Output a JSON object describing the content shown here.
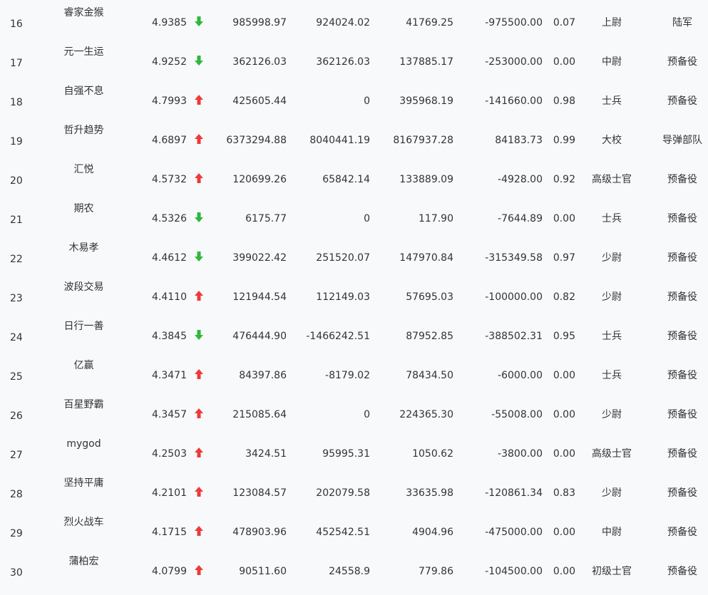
{
  "colors": {
    "up": "#ec3b3b",
    "down": "#2db83d",
    "text": "#333333",
    "background": "#f8f9fb"
  },
  "rows": [
    {
      "rank": "16",
      "name": "睿家金猴",
      "score": "4.9385",
      "trend": "down",
      "v1": "985998.97",
      "v2": "924024.02",
      "v3": "41769.25",
      "v4": "-975500.00",
      "ratio": "0.07",
      "title": "上尉",
      "unit": "陆军"
    },
    {
      "rank": "17",
      "name": "元一生运",
      "score": "4.9252",
      "trend": "down",
      "v1": "362126.03",
      "v2": "362126.03",
      "v3": "137885.17",
      "v4": "-253000.00",
      "ratio": "0.00",
      "title": "中尉",
      "unit": "预备役"
    },
    {
      "rank": "18",
      "name": "自强不息",
      "score": "4.7993",
      "trend": "up",
      "v1": "425605.44",
      "v2": "0",
      "v3": "395968.19",
      "v4": "-141660.00",
      "ratio": "0.98",
      "title": "士兵",
      "unit": "预备役"
    },
    {
      "rank": "19",
      "name": "哲升趋势",
      "score": "4.6897",
      "trend": "up",
      "v1": "6373294.88",
      "v2": "8040441.19",
      "v3": "8167937.28",
      "v4": "84183.73",
      "ratio": "0.99",
      "title": "大校",
      "unit": "导弹部队"
    },
    {
      "rank": "20",
      "name": "汇悦",
      "score": "4.5732",
      "trend": "up",
      "v1": "120699.26",
      "v2": "65842.14",
      "v3": "133889.09",
      "v4": "-4928.00",
      "ratio": "0.92",
      "title": "高级士官",
      "unit": "预备役"
    },
    {
      "rank": "21",
      "name": "期农",
      "score": "4.5326",
      "trend": "down",
      "v1": "6175.77",
      "v2": "0",
      "v3": "117.90",
      "v4": "-7644.89",
      "ratio": "0.00",
      "title": "士兵",
      "unit": "预备役"
    },
    {
      "rank": "22",
      "name": "木易孝",
      "score": "4.4612",
      "trend": "down",
      "v1": "399022.42",
      "v2": "251520.07",
      "v3": "147970.84",
      "v4": "-315349.58",
      "ratio": "0.97",
      "title": "少尉",
      "unit": "预备役"
    },
    {
      "rank": "23",
      "name": "波段交易",
      "score": "4.4110",
      "trend": "up",
      "v1": "121944.54",
      "v2": "112149.03",
      "v3": "57695.03",
      "v4": "-100000.00",
      "ratio": "0.82",
      "title": "少尉",
      "unit": "预备役"
    },
    {
      "rank": "24",
      "name": "日行一善",
      "score": "4.3845",
      "trend": "down",
      "v1": "476444.90",
      "v2": "-1466242.51",
      "v3": "87952.85",
      "v4": "-388502.31",
      "ratio": "0.95",
      "title": "士兵",
      "unit": "预备役"
    },
    {
      "rank": "25",
      "name": "亿赢",
      "score": "4.3471",
      "trend": "up",
      "v1": "84397.86",
      "v2": "-8179.02",
      "v3": "78434.50",
      "v4": "-6000.00",
      "ratio": "0.00",
      "title": "士兵",
      "unit": "预备役"
    },
    {
      "rank": "26",
      "name": "百星野霸",
      "score": "4.3457",
      "trend": "up",
      "v1": "215085.64",
      "v2": "0",
      "v3": "224365.30",
      "v4": "-55008.00",
      "ratio": "0.00",
      "title": "少尉",
      "unit": "预备役"
    },
    {
      "rank": "27",
      "name": "mygod",
      "score": "4.2503",
      "trend": "up",
      "v1": "3424.51",
      "v2": "95995.31",
      "v3": "1050.62",
      "v4": "-3800.00",
      "ratio": "0.00",
      "title": "高级士官",
      "unit": "预备役"
    },
    {
      "rank": "28",
      "name": "坚持平庸",
      "score": "4.2101",
      "trend": "up",
      "v1": "123084.57",
      "v2": "202079.58",
      "v3": "33635.98",
      "v4": "-120861.34",
      "ratio": "0.83",
      "title": "少尉",
      "unit": "预备役"
    },
    {
      "rank": "29",
      "name": "烈火战车",
      "score": "4.1715",
      "trend": "up",
      "v1": "478903.96",
      "v2": "452542.51",
      "v3": "4904.96",
      "v4": "-475000.00",
      "ratio": "0.00",
      "title": "中尉",
      "unit": "预备役"
    },
    {
      "rank": "30",
      "name": "蒲柏宏",
      "score": "4.0799",
      "trend": "up",
      "v1": "90511.60",
      "v2": "24558.9",
      "v3": "779.86",
      "v4": "-104500.00",
      "ratio": "0.00",
      "title": "初级士官",
      "unit": "预备役"
    }
  ]
}
